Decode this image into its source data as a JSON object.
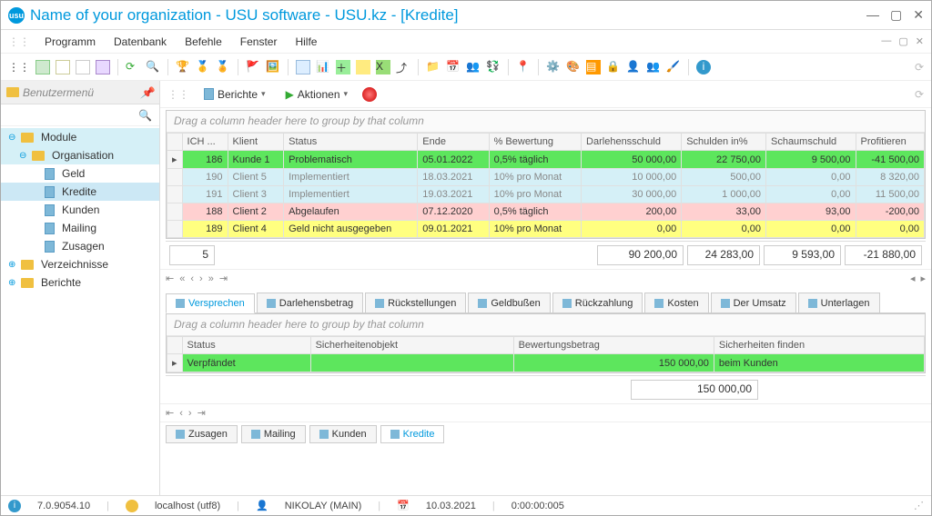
{
  "title": "Name of your organization - USU software - USU.kz - [Kredite]",
  "menu": [
    "Programm",
    "Datenbank",
    "Befehle",
    "Fenster",
    "Hilfe"
  ],
  "sidebar": {
    "header": "Benutzermenü",
    "items": [
      {
        "label": "Module",
        "level": 0,
        "folder": true,
        "expand": "−",
        "root": true
      },
      {
        "label": "Organisation",
        "level": 1,
        "folder": true,
        "expand": "−",
        "root": true
      },
      {
        "label": "Geld",
        "level": 2
      },
      {
        "label": "Kredite",
        "level": 2,
        "sel": true
      },
      {
        "label": "Kunden",
        "level": 2
      },
      {
        "label": "Mailing",
        "level": 2
      },
      {
        "label": "Zusagen",
        "level": 2
      },
      {
        "label": "Verzeichnisse",
        "level": 0,
        "folder": true,
        "expand": "+"
      },
      {
        "label": "Berichte",
        "level": 0,
        "folder": true,
        "expand": "+"
      }
    ]
  },
  "actions": {
    "berichte": "Berichte",
    "aktionen": "Aktionen"
  },
  "groupHint": "Drag a column header here to group by that column",
  "grid": {
    "headers": [
      "ICH ...",
      "Klient",
      "Status",
      "Ende",
      "% Bewertung",
      "Darlehensschuld",
      "Schulden in%",
      "Schaumschuld",
      "Profitieren"
    ],
    "rows": [
      {
        "cls": "row-green",
        "mark": "▸",
        "c": [
          "186",
          "Kunde 1",
          "Problematisch",
          "05.01.2022",
          "0,5% täglich",
          "50 000,00",
          "22 750,00",
          "9 500,00",
          "-41 500,00"
        ]
      },
      {
        "cls": "row-blue",
        "c": [
          "190",
          "Client 5",
          "Implementiert",
          "18.03.2021",
          "10% pro Monat",
          "10 000,00",
          "500,00",
          "0,00",
          "8 320,00"
        ]
      },
      {
        "cls": "row-blue",
        "c": [
          "191",
          "Client 3",
          "Implementiert",
          "19.03.2021",
          "10% pro Monat",
          "30 000,00",
          "1 000,00",
          "0,00",
          "11 500,00"
        ]
      },
      {
        "cls": "row-pink",
        "c": [
          "188",
          "Client 2",
          "Abgelaufen",
          "07.12.2020",
          "0,5% täglich",
          "200,00",
          "33,00",
          "93,00",
          "-200,00"
        ]
      },
      {
        "cls": "row-yellow",
        "c": [
          "189",
          "Client 4",
          "Geld nicht ausgegeben",
          "09.01.2021",
          "10% pro Monat",
          "0,00",
          "0,00",
          "0,00",
          "0,00"
        ]
      }
    ],
    "totals": {
      "count": "5",
      "darlehensschuld": "90 200,00",
      "schuldenpct": "24 283,00",
      "schaumschuld": "9 593,00",
      "profitieren": "-21 880,00"
    }
  },
  "subtabs": [
    "Versprechen",
    "Darlehensbetrag",
    "Rückstellungen",
    "Geldbußen",
    "Rückzahlung",
    "Kosten",
    "Der Umsatz",
    "Unterlagen"
  ],
  "subgrid": {
    "headers": [
      "Status",
      "Sicherheitenobjekt",
      "Bewertungsbetrag",
      "Sicherheiten finden"
    ],
    "row": {
      "cls": "row-green",
      "c": [
        "Verpfändet",
        "",
        "150 000,00",
        "beim Kunden"
      ]
    },
    "total": "150 000,00"
  },
  "bottomTabs": [
    "Zusagen",
    "Mailing",
    "Kunden",
    "Kredite"
  ],
  "status": {
    "version": "7.0.9054.10",
    "host": "localhost (utf8)",
    "user": "NIKOLAY (MAIN)",
    "date": "10.03.2021",
    "time": "0:00:00:005"
  }
}
